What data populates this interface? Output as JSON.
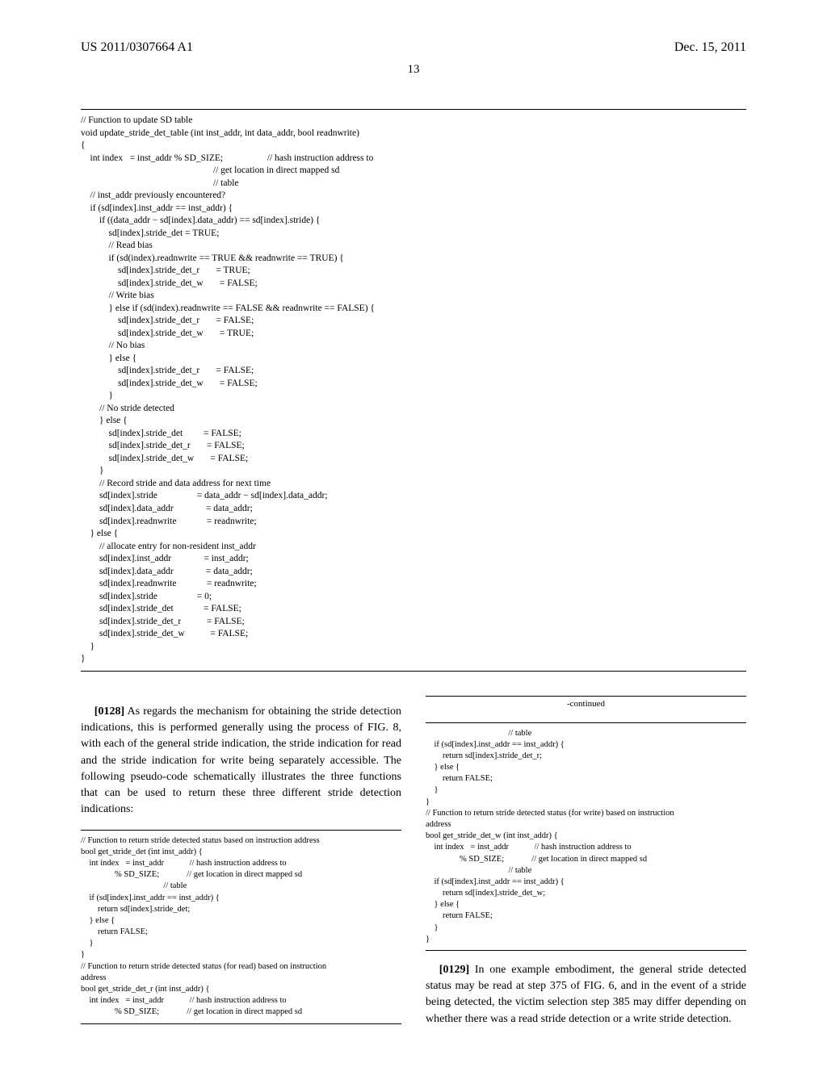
{
  "header": {
    "left": "US 2011/0307664 A1",
    "right": "Dec. 15, 2011"
  },
  "page_number": "13",
  "main_code": "// Function to update SD table\nvoid update_stride_det_table (int inst_addr, int data_addr, bool readnwrite)\n{\n    int index   = inst_addr % SD_SIZE;                   // hash instruction address to\n                                                         // get location in direct mapped sd\n                                                         // table\n    // inst_addr previously encountered?\n    if (sd[index].inst_addr == inst_addr) {\n        if ((data_addr − sd[index].data_addr) == sd[index].stride) {\n            sd[index].stride_det = TRUE;\n            // Read bias\n            if (sd(index).readnwrite == TRUE && readnwrite == TRUE) {\n                sd[index].stride_det_r       = TRUE;\n                sd[index].stride_det_w       = FALSE;\n            // Write bias\n            } else if (sd(index).readnwrite == FALSE && readnwrite == FALSE) {\n                sd[index].stride_det_r       = FALSE;\n                sd[index].stride_det_w       = TRUE;\n            // No bias\n            } else {\n                sd[index].stride_det_r       = FALSE;\n                sd[index].stride_det_w       = FALSE;\n            }\n        // No stride detected\n        } else {\n            sd[index].stride_det         = FALSE;\n            sd[index].stride_det_r       = FALSE;\n            sd[index].stride_det_w       = FALSE;\n        }\n        // Record stride and data address for next time\n        sd[index].stride                 = data_addr − sd[index].data_addr;\n        sd[index].data_addr              = data_addr;\n        sd[index].readnwrite             = readnwrite;\n    } else {\n        // allocate entry for non-resident inst_addr\n        sd[index].inst_addr              = inst_addr;\n        sd[index].data_addr              = data_addr;\n        sd[index].readnwrite             = readnwrite;\n        sd[index].stride                 = 0;\n        sd[index].stride_det             = FALSE;\n        sd[index].stride_det_r           = FALSE;\n        sd[index].stride_det_w           = FALSE;\n    }\n}",
  "para_0128": {
    "num": "[0128]",
    "text": "  As regards the mechanism for obtaining the stride detection indications, this is performed generally using the process of FIG. 8, with each of the general stride indication, the stride indication for read and the stride indication for write being separately accessible. The following pseudo-code schematically illustrates the three functions that can be used to return these three different stride detection indications:"
  },
  "col_left_code": "// Function to return stride detected status based on instruction address\nbool get_stride_det (int inst_addr) {\n    int index   = inst_addr            // hash instruction address to\n                % SD_SIZE;             // get location in direct mapped sd\n                                       // table\n    if (sd[index].inst_addr == inst_addr) {\n        return sd[index].stride_det;\n    } else {\n        return FALSE;\n    }\n}\n// Function to return stride detected status (for read) based on instruction\naddress\nbool get_stride_det_r (int inst_addr) {\n    int index   = inst_addr            // hash instruction address to\n                % SD_SIZE;             // get location in direct mapped sd",
  "continued_label": "-continued",
  "col_right_code": "                                       // table\n    if (sd[index].inst_addr == inst_addr) {\n        return sd[index].stride_det_r;\n    } else {\n        return FALSE;\n    }\n}\n// Function to return stride detected status (for write) based on instruction\naddress\nbool get_stride_det_w (int inst_addr) {\n    int index   = inst_addr            // hash instruction address to\n                % SD_SIZE;             // get location in direct mapped sd\n                                       // table\n    if (sd[index].inst_addr == inst_addr) {\n        return sd[index].stride_det_w;\n    } else {\n        return FALSE;\n    }\n}",
  "para_0129": {
    "num": "[0129]",
    "text": "  In one example embodiment, the general stride detected status may be read at step 375 of FIG. 6, and in the event of a stride being detected, the victim selection step 385 may differ depending on whether there was a read stride detection or a write stride detection."
  }
}
